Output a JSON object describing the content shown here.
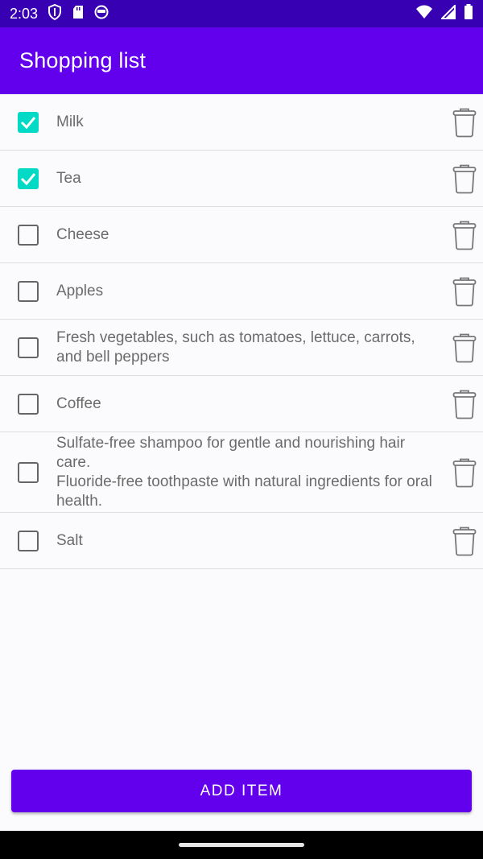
{
  "status_bar": {
    "time": "2:03",
    "icons": [
      "shield-icon",
      "sd-card-icon",
      "app-notification-icon",
      "wifi-icon",
      "cell-signal-icon",
      "battery-icon"
    ]
  },
  "app_bar": {
    "title": "Shopping list"
  },
  "items": [
    {
      "label": "Milk",
      "checked": true
    },
    {
      "label": "Tea",
      "checked": true
    },
    {
      "label": "Cheese",
      "checked": false
    },
    {
      "label": "Apples",
      "checked": false
    },
    {
      "label": "Fresh vegetables, such as tomatoes, lettuce, carrots, and bell peppers",
      "checked": false
    },
    {
      "label": "Coffee",
      "checked": false
    },
    {
      "label": "Sulfate-free shampoo for gentle and nourishing hair care.\nFluoride-free toothpaste with natural ingredients for oral health.",
      "checked": false
    },
    {
      "label": "Salt",
      "checked": false
    }
  ],
  "add_button": {
    "label": "ADD ITEM"
  },
  "colors": {
    "status_bar": "#3700b3",
    "primary": "#6200ee",
    "checkbox_checked": "#03dac5"
  }
}
